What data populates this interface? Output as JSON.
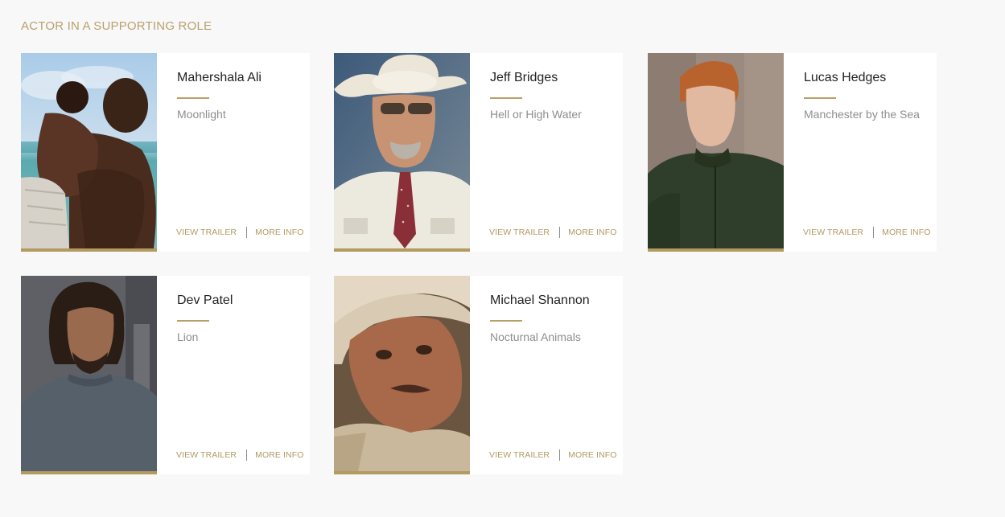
{
  "section": {
    "title": "ACTOR IN A SUPPORTING ROLE"
  },
  "colors": {
    "accent": "#b39a5e",
    "background": "#f8f8f8",
    "card": "#ffffff"
  },
  "nominees": [
    {
      "name": "Mahershala Ali",
      "film": "Moonlight",
      "trailer_label": "VIEW TRAILER",
      "info_label": "MORE INFO"
    },
    {
      "name": "Jeff Bridges",
      "film": "Hell or High Water",
      "trailer_label": "VIEW TRAILER",
      "info_label": "MORE INFO"
    },
    {
      "name": "Lucas Hedges",
      "film": "Manchester by the Sea",
      "trailer_label": "VIEW TRAILER",
      "info_label": "MORE INFO"
    },
    {
      "name": "Dev Patel",
      "film": "Lion",
      "trailer_label": "VIEW TRAILER",
      "info_label": "MORE INFO"
    },
    {
      "name": "Michael Shannon",
      "film": "Nocturnal Animals",
      "trailer_label": "VIEW TRAILER",
      "info_label": "MORE INFO"
    }
  ]
}
